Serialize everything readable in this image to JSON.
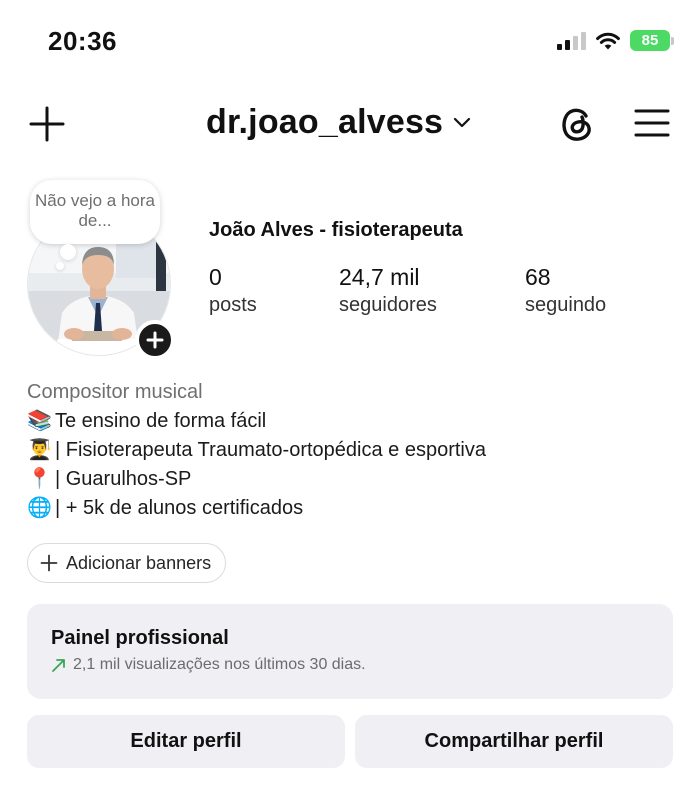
{
  "status_bar": {
    "time": "20:36",
    "battery_level": "85",
    "battery_color": "#4cd964",
    "icons": [
      "signal-icon",
      "wifi-icon",
      "battery-icon"
    ]
  },
  "header": {
    "username": "dr.joao_alvess",
    "icons": [
      "plus-icon",
      "chevron-down-icon",
      "threads-icon",
      "menu-icon"
    ]
  },
  "profile": {
    "note_text": "Não vejo a hora de...",
    "display_name": "João Alves - fisioterapeuta",
    "stats": [
      {
        "value": "0",
        "label": "posts"
      },
      {
        "value": "24,7 mil",
        "label": "seguidores"
      },
      {
        "value": "68",
        "label": "seguindo"
      }
    ]
  },
  "bio": {
    "category": "Compositor musical",
    "lines": [
      {
        "emoji": "📚",
        "text": "Te ensino de forma fácil"
      },
      {
        "emoji": "👨‍🎓",
        "text": "| Fisioterapeuta Traumato-ortopédica e esportiva"
      },
      {
        "emoji": "📍",
        "text": "| Guarulhos-SP"
      },
      {
        "emoji": "🌐",
        "text": "| + 5k de alunos certificados"
      }
    ]
  },
  "banner_button": {
    "label": "Adicionar banners"
  },
  "dashboard": {
    "title": "Painel profissional",
    "subtitle": "2,1 mil visualizações nos últimos 30 dias.",
    "trend_color": "#3aa655"
  },
  "actions": {
    "edit_label": "Editar perfil",
    "share_label": "Compartilhar perfil"
  }
}
